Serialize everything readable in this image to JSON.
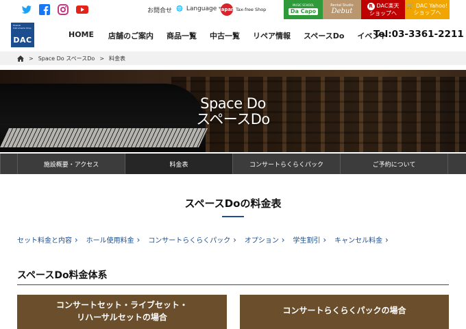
{
  "topbar": {
    "social": [
      "twitter-icon",
      "facebook-icon",
      "instagram-icon",
      "youtube-icon"
    ],
    "inquiry": "お問合せ",
    "language": "Language",
    "tax_free_mark": "Japan",
    "tax_free": "Tax-free Shop",
    "capo_sub": "MUSIC SCHOOL",
    "capo_logo": "Da Capo",
    "debut_sub": "Rental Studio",
    "debut_logo": "Debut",
    "rakuten_line1": "DAC楽天",
    "rakuten_line2": "ショップへ",
    "yahoo_line1": "DAC Yahoo!",
    "yahoo_line2": "ショップへ"
  },
  "header": {
    "logo_small": "Musical Instruments Shop",
    "logo": "DAC",
    "nav": [
      "HOME",
      "店舗のご案内",
      "商品一覧",
      "中古一覧",
      "リペア情報",
      "スペースDo",
      "イベント"
    ],
    "tel": "Tel:03-3361-2211"
  },
  "breadcrumb": {
    "home": "home-icon",
    "items": [
      "Space Do スペースDo",
      "料金表"
    ]
  },
  "hero": {
    "title_en": "Space Do",
    "title_ja": "スペースDo"
  },
  "tabs": [
    "施設概要・アクセス",
    "料金表",
    "コンサートらくらくパック",
    "ご予約について"
  ],
  "content": {
    "section_title": "スペースDoの料金表",
    "anchors": [
      "セット料金と内容",
      "ホール使用料金",
      "コンサートらくらくパック",
      "オプション",
      "学生割引",
      "キャンセル料金"
    ],
    "h2": "スペースDo料金体系",
    "card1_line1": "コンサートセット・ライブセット・",
    "card1_line2": "リハーサルセットの場合",
    "card2": "コンサートらくらくパックの場合"
  },
  "colors": {
    "brand_blue": "#1b4d8f",
    "card_brown": "#6b4e2b",
    "tab_dark": "#3c3c3c",
    "rakuten_red": "#bf0000",
    "yahoo_orange": "#f0a500",
    "capo_green": "#2f9a3a"
  }
}
